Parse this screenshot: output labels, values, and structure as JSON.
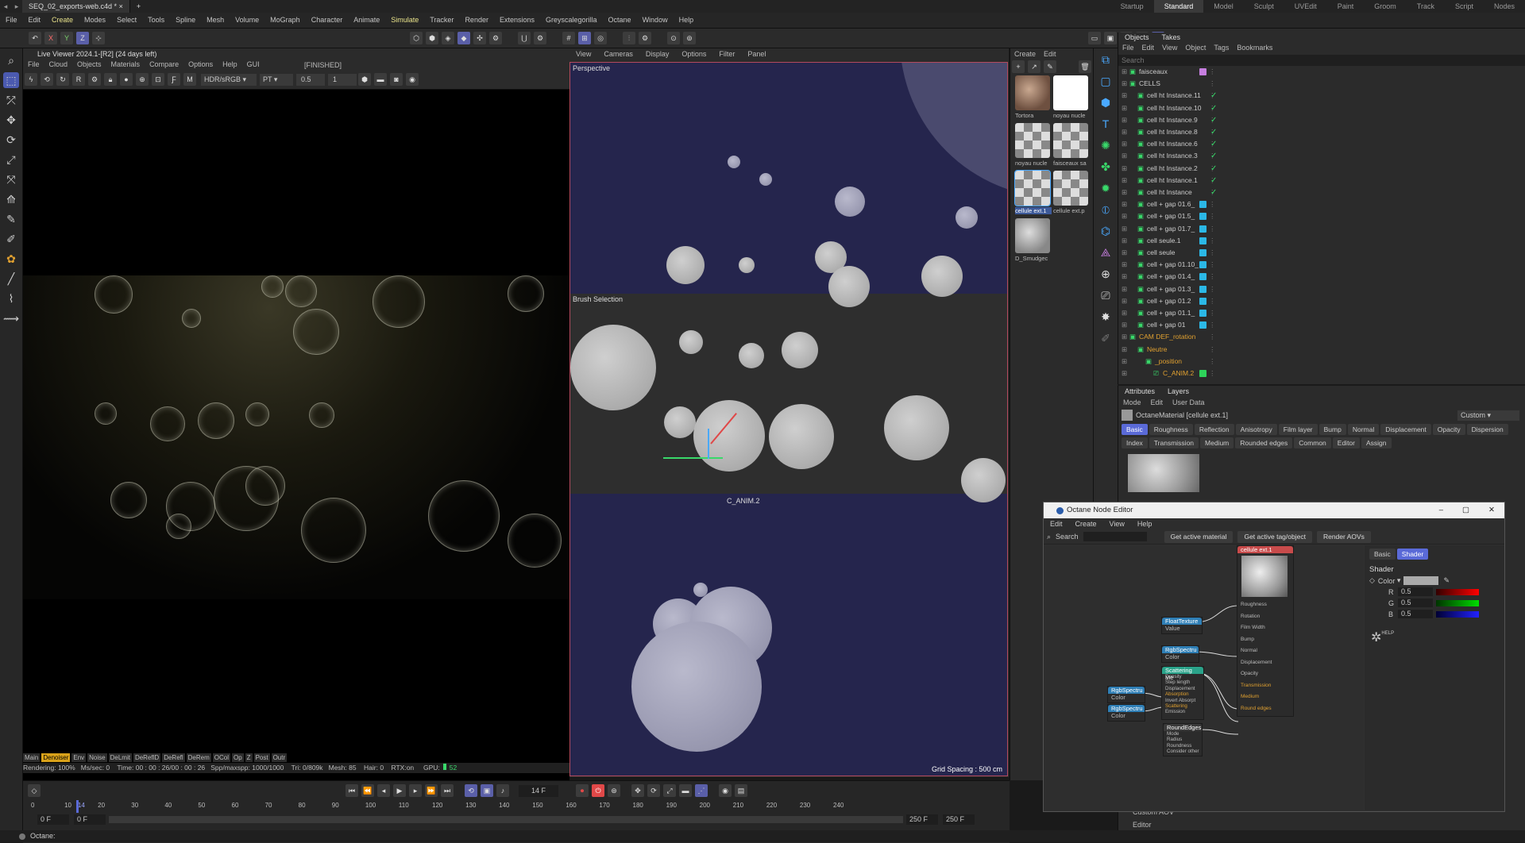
{
  "app": {
    "document_tab": "SEQ_02_exports-web.c4d *",
    "new_tab": "+",
    "menu": [
      "File",
      "Edit",
      "Create",
      "Modes",
      "Select",
      "Tools",
      "Spline",
      "Mesh",
      "Volume",
      "MoGraph",
      "Character",
      "Animate",
      "Simulate",
      "Tracker",
      "Render",
      "Extensions",
      "Greyscalegorilla",
      "Octane",
      "Window",
      "Help"
    ],
    "layouts": [
      "Startup",
      "Standard",
      "Model",
      "Sculpt",
      "UVEdit",
      "Paint",
      "Groom",
      "Track",
      "Script",
      "Nodes"
    ],
    "active_layout": "Standard"
  },
  "toolbar": {
    "x": "X",
    "y": "Y",
    "z": "Z"
  },
  "live_viewer": {
    "title": "Live Viewer 2024.1-[R2] (24 days left)",
    "menu": [
      "File",
      "Cloud",
      "Objects",
      "Materials",
      "Compare",
      "Options",
      "Help",
      "GUI"
    ],
    "state": "[FINISHED]",
    "colorspace": "HDR/sRGB",
    "kernel": "PT",
    "value1": "0.5",
    "value2": "1",
    "tabs": [
      "Main",
      "Denoiser",
      "Env",
      "Noise",
      "DeLmit",
      "DeReflD",
      "DeRefl",
      "DeRem",
      "OCol",
      "Op",
      "Z",
      "Post",
      "Outr"
    ],
    "active_tab": "Denoiser",
    "status": "Rendering: 100%   Ms/sec: 0    Time: 00 : 00 : 26/00 : 00 : 26   Spp/maxspp: 1000/1000    Tri: 0/809k   Mesh: 85    Hair: 0    RTX:on     GPU:",
    "gpu": "52"
  },
  "viewport": {
    "menu": [
      "View",
      "Cameras",
      "Display",
      "Options",
      "Filter",
      "Panel"
    ],
    "label": "Perspective",
    "brush_label": "Brush Selection",
    "camera_label": "C_ANIM.2",
    "grid_spacing": "Grid Spacing : 500 cm"
  },
  "materials": {
    "menu": [
      "Create",
      "Edit"
    ],
    "items": [
      "Tortora",
      "noyau nucle",
      "noyau nucle",
      "faisceaux sa",
      "cellule ext.1",
      "cellule ext.p",
      "D_Smudgec"
    ]
  },
  "objects": {
    "tabs": [
      "Objects",
      "Takes"
    ],
    "menu": [
      "File",
      "Edit",
      "View",
      "Object",
      "Tags",
      "Bookmarks"
    ],
    "search_placeholder": "Search",
    "rows": [
      {
        "name": "faisceaux",
        "chip": "#c77fe0",
        "check": false
      },
      {
        "name": "CELLS",
        "chip": "",
        "check": false
      },
      {
        "name": "cell ht Instance.11",
        "chip": "",
        "check": true
      },
      {
        "name": "cell ht Instance.10",
        "chip": "",
        "check": true
      },
      {
        "name": "cell ht Instance.9",
        "chip": "",
        "check": true
      },
      {
        "name": "cell ht Instance.8",
        "chip": "",
        "check": true
      },
      {
        "name": "cell ht Instance.6",
        "chip": "",
        "check": true
      },
      {
        "name": "cell ht Instance.3",
        "chip": "",
        "check": true
      },
      {
        "name": "cell ht Instance.2",
        "chip": "",
        "check": true
      },
      {
        "name": "cell ht Instance.1",
        "chip": "",
        "check": true
      },
      {
        "name": "cell ht Instance",
        "chip": "",
        "check": true
      },
      {
        "name": "cell + gap 01.6_",
        "chip": "#2bb8e6",
        "check": false
      },
      {
        "name": "cell + gap 01.5_",
        "chip": "#2bb8e6",
        "check": false
      },
      {
        "name": "cell + gap 01.7_",
        "chip": "#2bb8e6",
        "check": false
      },
      {
        "name": "cell seule.1",
        "chip": "#2bb8e6",
        "check": false
      },
      {
        "name": "cell seule",
        "chip": "#2bb8e6",
        "check": false
      },
      {
        "name": "cell + gap 01.10_",
        "chip": "#2bb8e6",
        "check": false
      },
      {
        "name": "cell + gap 01.4_",
        "chip": "#2bb8e6",
        "check": false
      },
      {
        "name": "cell + gap 01.3_",
        "chip": "#2bb8e6",
        "check": false
      },
      {
        "name": "cell + gap 01.2",
        "chip": "#2bb8e6",
        "check": false
      },
      {
        "name": "cell + gap 01.1_",
        "chip": "#2bb8e6",
        "check": false
      },
      {
        "name": "cell + gap 01",
        "chip": "#2bb8e6",
        "check": false
      },
      {
        "name": "CAM DEF_rotation",
        "chip": "",
        "check": false
      },
      {
        "name": "Neutre",
        "chip": "",
        "check": false
      },
      {
        "name": "_position",
        "chip": "",
        "check": false
      },
      {
        "name": "C_ANIM.2",
        "chip": "#2ed35a",
        "check": false
      }
    ]
  },
  "attributes": {
    "tabs": [
      "Attributes",
      "Layers"
    ],
    "menu": [
      "Mode",
      "Edit",
      "User Data"
    ],
    "title": "OctaneMaterial [cellule ext.1]",
    "preset": "Custom",
    "pills_row1": [
      "Basic",
      "Roughness",
      "Reflection",
      "Anisotropy",
      "Film layer",
      "Bump",
      "Normal",
      "Displacement",
      "Opacity",
      "Dispersion"
    ],
    "pills_row2": [
      "Index",
      "Transmission",
      "Medium",
      "Rounded edges",
      "Common",
      "Editor",
      "Assign"
    ],
    "custom_aov": "Custom AOV",
    "editor": "Editor"
  },
  "node_editor": {
    "title": "Octane Node Editor",
    "menu": [
      "Edit",
      "Create",
      "View",
      "Help"
    ],
    "search_label": "Search",
    "buttons": [
      "Get active material",
      "Get active tag/object",
      "Render AOVs"
    ],
    "side_tabs": [
      "Basic",
      "Shader"
    ],
    "active_side_tab": "Shader",
    "shader_label": "Shader",
    "color_label": "Color",
    "r_label": "R",
    "g_label": "G",
    "b_label": "B",
    "r": "0.5",
    "g": "0.5",
    "b": "0.5",
    "help": "HELP",
    "material_node": "cellule ext.1",
    "material_ports": [
      "Roughness",
      "Rotation",
      "Film Width",
      "Bump",
      "Normal",
      "Displacement",
      "Opacity",
      "Transmission",
      "Medium",
      "Round edges"
    ],
    "float_node": "FloatTexture",
    "float_port": "Value",
    "rgb_node1": "RgbSpectru",
    "rgb_port1": "Color",
    "scatter_node": "Scattering Me",
    "scatter_ports": [
      "Density",
      "Step length",
      "Displacement",
      "Absorption",
      "Invert Absorpt",
      "Scattering",
      "Emission"
    ],
    "rgb_node2": "RgbSpectru",
    "rgb_port2": "Color",
    "rgb_node3": "RgbSpectru",
    "rgb_port3": "Color",
    "round_node": "RoundEdges",
    "round_ports": [
      "Mode",
      "Radius",
      "Roundness",
      "Consider other"
    ]
  },
  "timeline": {
    "current_frame": "14 F",
    "ticks": [
      "0",
      "10",
      "14",
      "20",
      "30",
      "40",
      "50",
      "60",
      "70",
      "80",
      "90",
      "100",
      "110",
      "120",
      "130",
      "140",
      "150",
      "160",
      "170",
      "180",
      "190",
      "200",
      "210",
      "220",
      "230",
      "240"
    ],
    "start": "0 F",
    "start2": "0 F",
    "end": "250 F",
    "end2": "250 F",
    "playhead": 14,
    "range_end": 240
  },
  "status": {
    "text": "Octane:"
  }
}
